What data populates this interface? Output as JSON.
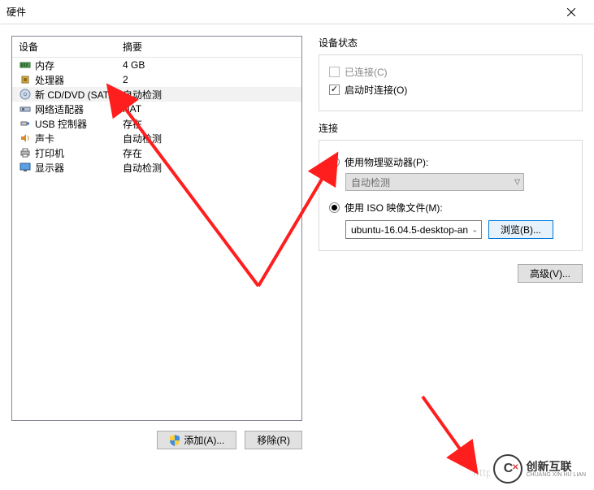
{
  "title": "硬件",
  "columns": {
    "device": "设备",
    "summary": "摘要"
  },
  "devices": [
    {
      "icon": "memory",
      "name": "内存",
      "summary": "4 GB",
      "selected": false
    },
    {
      "icon": "cpu",
      "name": "处理器",
      "summary": "2",
      "selected": false
    },
    {
      "icon": "disc",
      "name": "新 CD/DVD (SAT...",
      "summary": "自动检测",
      "selected": true
    },
    {
      "icon": "nic",
      "name": "网络适配器",
      "summary": "NAT",
      "selected": false
    },
    {
      "icon": "usb",
      "name": "USB 控制器",
      "summary": "存在",
      "selected": false
    },
    {
      "icon": "sound",
      "name": "声卡",
      "summary": "自动检测",
      "selected": false
    },
    {
      "icon": "printer",
      "name": "打印机",
      "summary": "存在",
      "selected": false
    },
    {
      "icon": "display",
      "name": "显示器",
      "summary": "自动检测",
      "selected": false
    }
  ],
  "status_group": {
    "label": "设备状态",
    "connected": {
      "label": "已连接(C)",
      "checked": false,
      "disabled": true
    },
    "connect_poweron": {
      "label": "启动时连接(O)",
      "checked": true
    }
  },
  "connect_group": {
    "label": "连接",
    "radio_physical": {
      "label": "使用物理驱动器(P):",
      "checked": false
    },
    "physical_select": "自动检测",
    "radio_iso": {
      "label": "使用 ISO 映像文件(M):",
      "checked": true
    },
    "iso_value": "ubuntu-16.04.5-desktop-an",
    "browse": "浏览(B)..."
  },
  "advanced": "高级(V)...",
  "add": "添加(A)...",
  "remove": "移除(R)",
  "close": "关闭",
  "watermark": "https://blog.csdn.net",
  "logo": {
    "main": "创新互联",
    "sub": "CHUANG XIN HU LIAN"
  }
}
